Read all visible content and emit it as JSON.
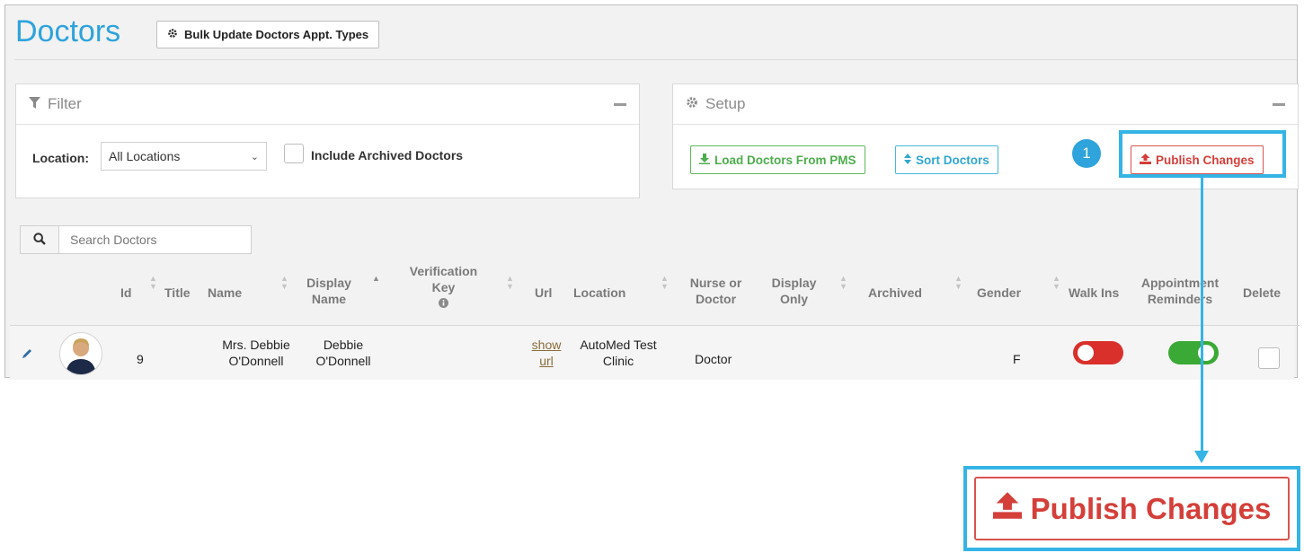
{
  "header": {
    "title": "Doctors",
    "bulk_update_label": "Bulk Update Doctors Appt. Types"
  },
  "filter": {
    "title": "Filter",
    "location_label": "Location:",
    "location_value": "All Locations",
    "include_archived_label": "Include Archived Doctors",
    "include_archived_checked": false
  },
  "setup": {
    "title": "Setup",
    "load_label": "Load Doctors From PMS",
    "sort_label": "Sort Doctors",
    "publish_label": "Publish Changes"
  },
  "annotation": {
    "step_number": "1",
    "zoom_label": "Publish Changes",
    "highlight_color": "#35b4e5"
  },
  "search": {
    "placeholder": "Search Doctors"
  },
  "table": {
    "columns": {
      "id": "Id",
      "title": "Title",
      "name": "Name",
      "display_name_1": "Display",
      "display_name_2": "Name",
      "verification_1": "Verification",
      "verification_2": "Key",
      "url": "Url",
      "location": "Location",
      "nurse_1": "Nurse or",
      "nurse_2": "Doctor",
      "display_only_1": "Display",
      "display_only_2": "Only",
      "archived": "Archived",
      "gender": "Gender",
      "walk_ins": "Walk Ins",
      "reminders_1": "Appointment",
      "reminders_2": "Reminders",
      "delete": "Delete"
    },
    "rows": [
      {
        "id": "9",
        "name_1": "Mrs. Debbie",
        "name_2": "O'Donnell",
        "display_1": "Debbie",
        "display_2": "O'Donnell",
        "url_1": "show",
        "url_2": "url",
        "location_1": "AutoMed Test",
        "location_2": "Clinic",
        "role": "Doctor",
        "gender": "F",
        "walk_ins": false,
        "reminders": true,
        "delete_checked": false
      }
    ]
  },
  "colors": {
    "brand_blue": "#2ea3dc",
    "danger": "#d9534f",
    "success": "#5cb85c",
    "info": "#46b8da",
    "toggle_off": "#d9302c",
    "toggle_on": "#3aa935"
  }
}
